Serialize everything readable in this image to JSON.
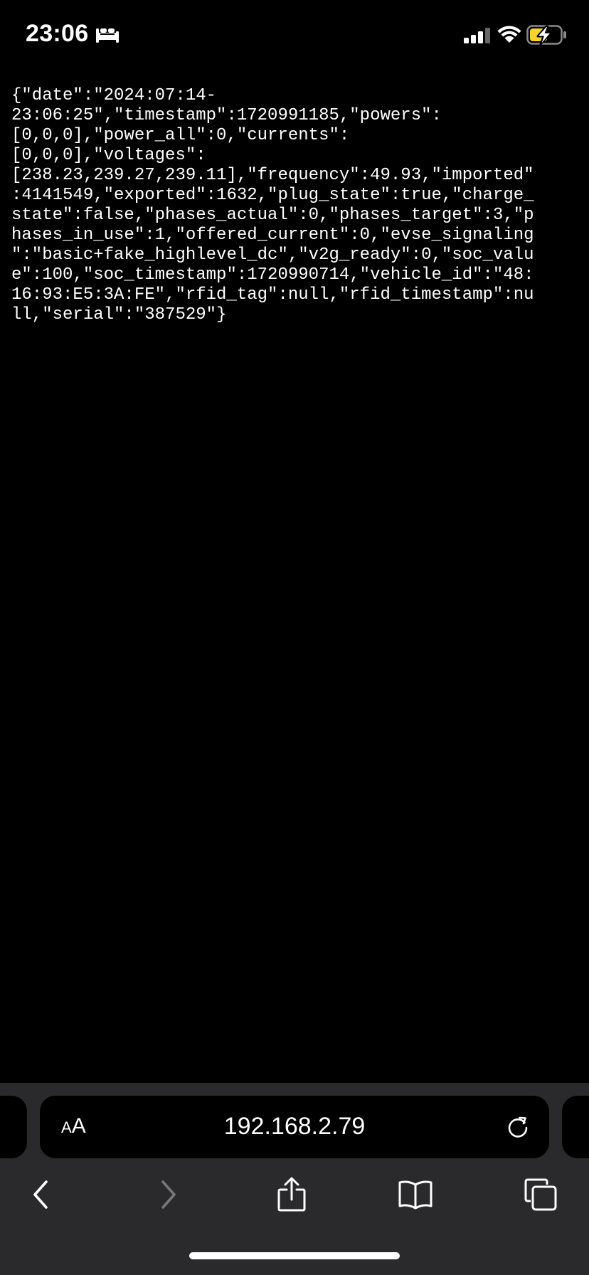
{
  "status_bar": {
    "time": "23:06",
    "focus_mode_icon": "bed-icon",
    "signal_icon": "cellular-signal-icon",
    "wifi_icon": "wifi-icon",
    "battery_icon": "battery-charging-icon",
    "battery_color": "#f5d42b"
  },
  "page": {
    "body_text": "{\"date\":\"2024:07:14-23:06:25\",\"timestamp\":1720991185,\"powers\":[0,0,0],\"power_all\":0,\"currents\":[0,0,0],\"voltages\":[238.23,239.27,239.11],\"frequency\":49.93,\"imported\":4141549,\"exported\":1632,\"plug_state\":true,\"charge_state\":false,\"phases_actual\":0,\"phases_target\":3,\"phases_in_use\":1,\"offered_current\":0,\"evse_signaling\":\"basic+fake_highlevel_dc\",\"v2g_ready\":0,\"soc_value\":100,\"soc_timestamp\":1720990714,\"vehicle_id\":\"48:16:93:E5:3A:FE\",\"rfid_tag\":null,\"rfid_timestamp\":null,\"serial\":\"387529\"}",
    "body_lines": [
      "{\"date\":\"2024:07:14-",
      "23:06:25\",\"timestamp\":1720991185,\"powers\":",
      "[0,0,0],\"power_all\":0,\"currents\":",
      "[0,0,0],\"voltages\":",
      "[238.23,239.27,239.11],\"frequency\":49.93,\"imported\"",
      ":4141549,\"exported\":1632,\"plug_state\":true,\"charge_",
      "state\":false,\"phases_actual\":0,\"phases_target\":3,\"p",
      "hases_in_use\":1,\"offered_current\":0,\"evse_signaling",
      "\":\"basic+fake_highlevel_dc\",\"v2g_ready\":0,\"soc_valu",
      "e\":100,\"soc_timestamp\":1720990714,\"vehicle_id\":\"48:",
      "16:93:E5:3A:FE\",\"rfid_tag\":null,\"rfid_timestamp\":nu",
      "ll,\"serial\":\"387529\"}"
    ]
  },
  "address_bar": {
    "aa_small": "A",
    "aa_large": "A",
    "url": "192.168.2.79",
    "reload_icon": "reload-icon"
  },
  "toolbar": {
    "back_icon": "chevron-left-icon",
    "forward_icon": "chevron-right-icon",
    "share_icon": "share-icon",
    "bookmarks_icon": "book-icon",
    "tabs_icon": "tabs-icon"
  }
}
